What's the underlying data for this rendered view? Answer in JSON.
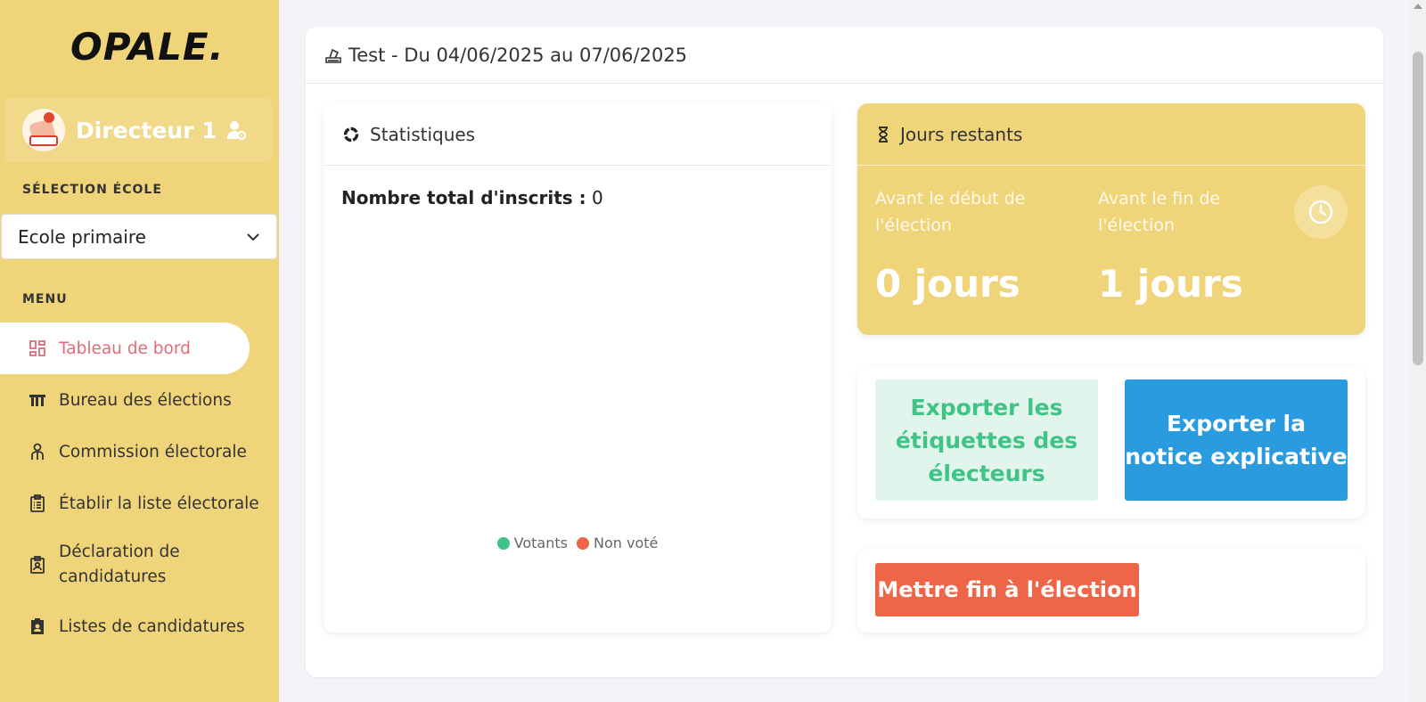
{
  "brand": {
    "logo": "OPALE."
  },
  "user": {
    "name": "Directeur 1"
  },
  "sidebar": {
    "school_section_label": "SÉLECTION ÉCOLE",
    "school_selected": "Ecole primaire",
    "menu_label": "MENU",
    "items": [
      {
        "label": "Tableau de bord",
        "icon": "dashboard-icon"
      },
      {
        "label": "Bureau des élections",
        "icon": "booth-icon"
      },
      {
        "label": "Commission électorale",
        "icon": "commission-icon"
      },
      {
        "label": "Établir la liste électorale",
        "icon": "clipboard-list-icon"
      },
      {
        "label": "Déclaration de candidatures",
        "icon": "clipboard-person-icon"
      },
      {
        "label": "Listes de candidatures",
        "icon": "id-badge-icon"
      }
    ]
  },
  "election": {
    "title": "Test - Du 04/06/2025 au 07/06/2025"
  },
  "stats": {
    "title": "Statistiques",
    "total_label": "Nombre total d'inscrits :",
    "total_value": "0",
    "legend": [
      {
        "name": "Votants",
        "color": "#3fc486"
      },
      {
        "name": "Non voté",
        "color": "#ee6647"
      }
    ]
  },
  "days": {
    "title": "Jours restants",
    "before_start_label": "Avant le début de l'élection",
    "before_start_value": "0 jours",
    "before_end_label": "Avant le fin de l'élection",
    "before_end_value": "1 jours"
  },
  "actions": {
    "export_labels": "Exporter les étiquettes des électeurs",
    "export_notice": "Exporter la notice explicative",
    "end_election": "Mettre fin à l'élection"
  },
  "colors": {
    "sidebar_bg": "#f0d47a",
    "active_nav": "#e36a78",
    "green": "#3fc486",
    "blue": "#2b9be0",
    "red": "#ee6647"
  }
}
